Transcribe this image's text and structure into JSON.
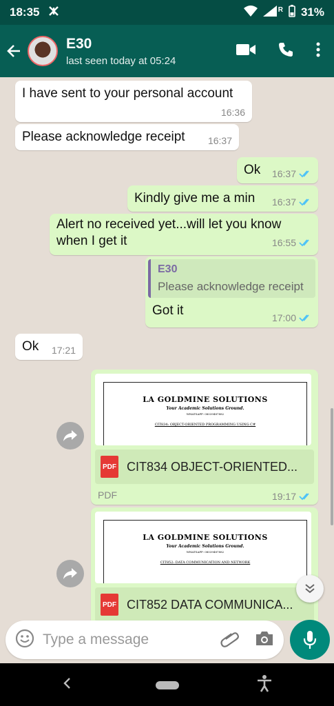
{
  "status": {
    "time": "18:35",
    "battery": "31%",
    "network_badge": "R"
  },
  "header": {
    "name": "E30",
    "last_seen": "last seen today at 05:24"
  },
  "messages": [
    {
      "text": "I have sent to your personal account",
      "time": "16:36"
    },
    {
      "text": "Please acknowledge receipt",
      "time": "16:37"
    },
    {
      "text": "Ok",
      "time": "16:37"
    },
    {
      "text": "Kindly give me a min",
      "time": "16:37"
    },
    {
      "text": "Alert no received yet...will let you know when I get it",
      "time": "16:55"
    },
    {
      "quote_name": "E30",
      "quote_text": "Please acknowledge receipt",
      "text": "Got it",
      "time": "17:00"
    },
    {
      "text": "Ok",
      "time": "17:21"
    }
  ],
  "documents": [
    {
      "preview_title": "LA GOLDMINE SOLUTIONS",
      "preview_subtitle": "Your Academic Solutions Ground.",
      "preview_line": "WHATSAPP: 08039487882",
      "preview_heading": "CIT834: OBJECT-ORIENTED PROGRAMMING USING C#",
      "name": "CIT834 OBJECT-ORIENTED...",
      "type": "PDF",
      "time": "19:17"
    },
    {
      "preview_title": "LA GOLDMINE SOLUTIONS",
      "preview_subtitle": "Your Academic Solutions Ground.",
      "preview_line": "WHATSAPP: 08039487882",
      "preview_heading": "CIT852: DATA COMMUNICATION AND NETWORK",
      "name": "CIT852 DATA COMMUNICA...",
      "type": "PDF"
    }
  ],
  "input": {
    "placeholder": "Type a message"
  },
  "colors": {
    "header": "#075e54",
    "statusbar": "#054d44",
    "outgoing": "#dcf8c6",
    "incoming": "#ffffff",
    "chat_bg": "#e5ddd5",
    "tick": "#4fc3f7",
    "mic": "#00897b"
  }
}
